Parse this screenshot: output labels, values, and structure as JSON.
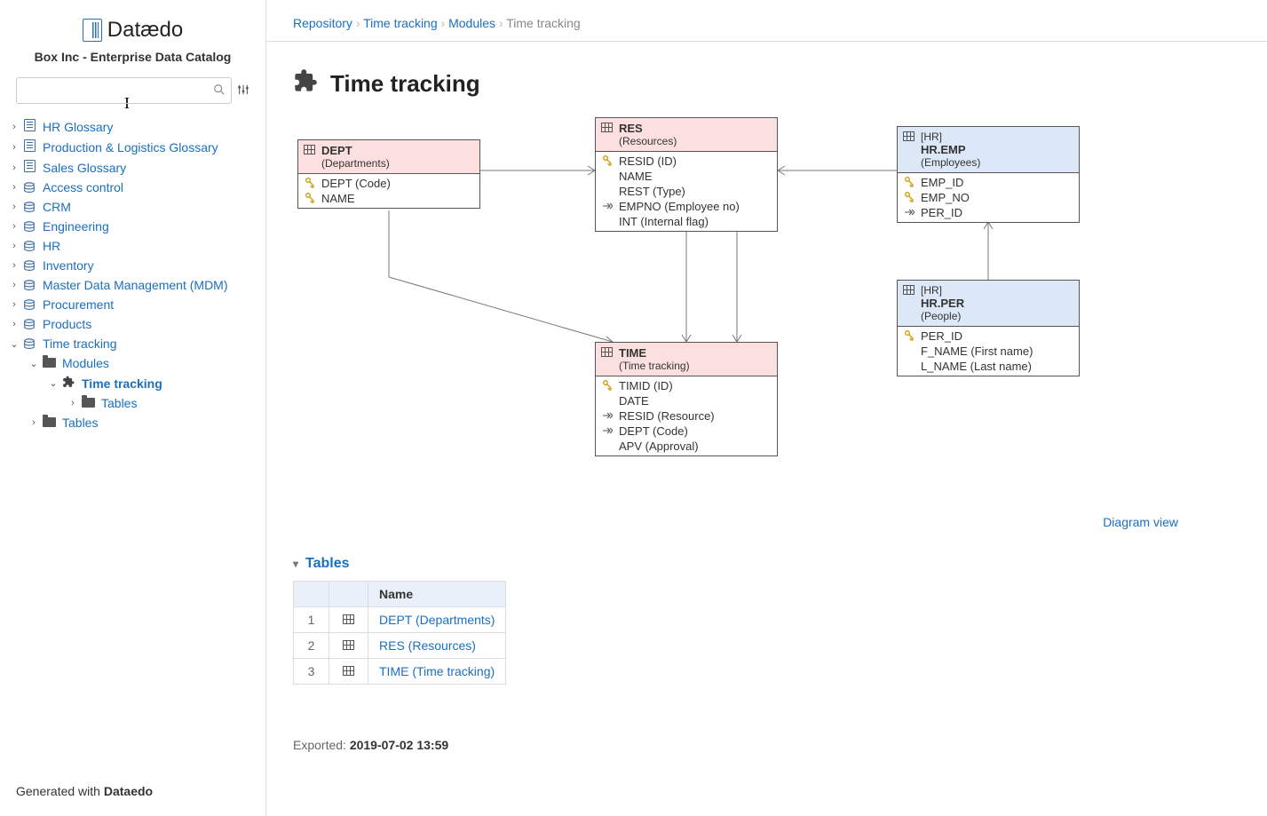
{
  "logo": {
    "brand": "Datædo",
    "subtitle": "Box Inc - Enterprise Data Catalog"
  },
  "search": {
    "placeholder": ""
  },
  "sidebar": {
    "items": [
      {
        "label": "HR Glossary",
        "icon": "book"
      },
      {
        "label": "Production & Logistics Glossary",
        "icon": "book"
      },
      {
        "label": "Sales Glossary",
        "icon": "book"
      },
      {
        "label": "Access control",
        "icon": "db"
      },
      {
        "label": "CRM",
        "icon": "db"
      },
      {
        "label": "Engineering",
        "icon": "db"
      },
      {
        "label": "HR",
        "icon": "db"
      },
      {
        "label": "Inventory",
        "icon": "db"
      },
      {
        "label": "Master Data Management (MDM)",
        "icon": "db"
      },
      {
        "label": "Procurement",
        "icon": "db"
      },
      {
        "label": "Products",
        "icon": "db"
      },
      {
        "label": "Time tracking",
        "icon": "db",
        "expanded": true,
        "children": [
          {
            "label": "Modules",
            "icon": "folder",
            "expanded": true,
            "children": [
              {
                "label": "Time tracking",
                "icon": "puzzle",
                "current": true,
                "expanded": true,
                "children": [
                  {
                    "label": "Tables",
                    "icon": "folder"
                  }
                ]
              }
            ]
          },
          {
            "label": "Tables",
            "icon": "folder"
          }
        ]
      }
    ]
  },
  "footer": {
    "prefix": "Generated with ",
    "brand": "Dataedo"
  },
  "breadcrumb": [
    {
      "label": "Repository",
      "link": true
    },
    {
      "label": "Time tracking",
      "link": true
    },
    {
      "label": "Modules",
      "link": true
    },
    {
      "label": "Time tracking",
      "link": false
    }
  ],
  "page": {
    "title": "Time tracking"
  },
  "diagram": {
    "nodes": {
      "dept": {
        "name": "DEPT",
        "desc": "(Departments)",
        "cols": [
          {
            "icon": "pk",
            "text": "DEPT (Code)"
          },
          {
            "icon": "pk",
            "text": "NAME"
          }
        ]
      },
      "res": {
        "name": "RES",
        "desc": "(Resources)",
        "cols": [
          {
            "icon": "pk",
            "text": "RESID (ID)"
          },
          {
            "icon": "",
            "text": "NAME"
          },
          {
            "icon": "",
            "text": "REST (Type)"
          },
          {
            "icon": "fk",
            "text": "EMPNO (Employee no)"
          },
          {
            "icon": "",
            "text": "INT (Internal flag)"
          }
        ]
      },
      "hremp": {
        "context": "[HR]",
        "name": "HR.EMP",
        "desc": "(Employees)",
        "cols": [
          {
            "icon": "pk",
            "text": "EMP_ID"
          },
          {
            "icon": "pk",
            "text": "EMP_NO"
          },
          {
            "icon": "fk",
            "text": "PER_ID"
          }
        ]
      },
      "time": {
        "name": "TIME",
        "desc": "(Time tracking)",
        "cols": [
          {
            "icon": "pk",
            "text": "TIMID (ID)"
          },
          {
            "icon": "",
            "text": "DATE"
          },
          {
            "icon": "fk",
            "text": "RESID (Resource)"
          },
          {
            "icon": "fk",
            "text": "DEPT (Code)"
          },
          {
            "icon": "",
            "text": "APV (Approval)"
          }
        ]
      },
      "hrper": {
        "context": "[HR]",
        "name": "HR.PER",
        "desc": "(People)",
        "cols": [
          {
            "icon": "pk",
            "text": "PER_ID"
          },
          {
            "icon": "",
            "text": "F_NAME (First name)"
          },
          {
            "icon": "",
            "text": "L_NAME (Last name)"
          }
        ]
      }
    },
    "view_link": "Diagram view"
  },
  "tables_section": {
    "title": "Tables",
    "header_name": "Name",
    "rows": [
      {
        "n": "1",
        "label": "DEPT (Departments)"
      },
      {
        "n": "2",
        "label": "RES (Resources)"
      },
      {
        "n": "3",
        "label": "TIME (Time tracking)"
      }
    ]
  },
  "exported": {
    "prefix": "Exported: ",
    "value": "2019-07-02 13:59"
  }
}
